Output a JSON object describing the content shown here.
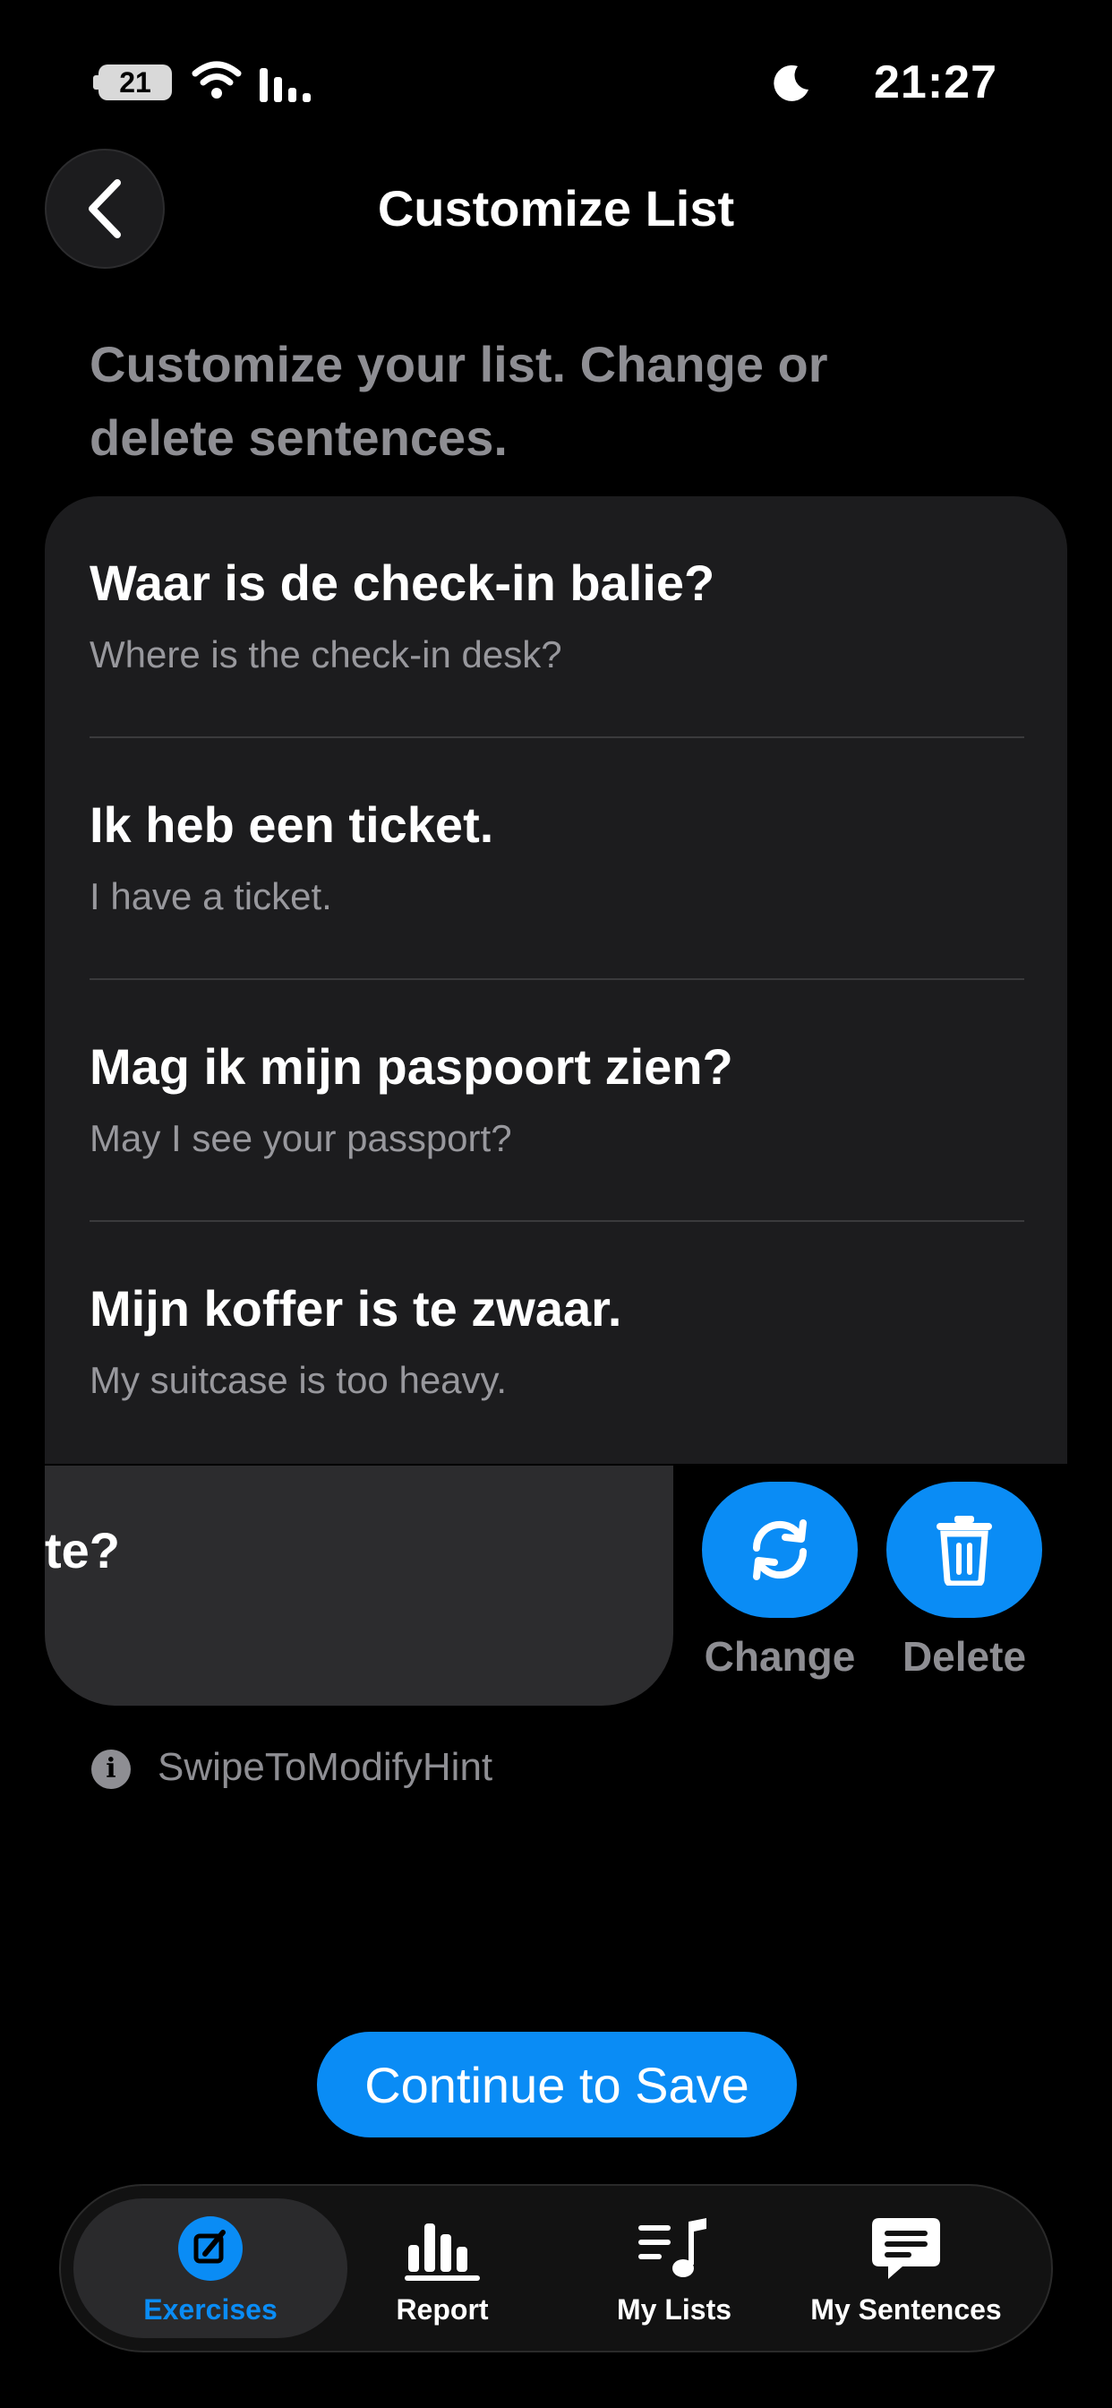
{
  "status_bar": {
    "time": "21:27",
    "battery": "21"
  },
  "header": {
    "title": "Customize List",
    "back_icon": "chevron-left-icon"
  },
  "intro": "Customize your list. Change or delete sentences.",
  "sentences": [
    {
      "nl": "Waar is de check-in balie?",
      "en": "Where is the check-in desk?"
    },
    {
      "nl": "Ik heb een ticket.",
      "en": "I have a ticket."
    },
    {
      "nl": "Mag ik mijn paspoort zien?",
      "en": "May I see your passport?"
    },
    {
      "nl": "Mijn koffer is te zwaar.",
      "en": "My suitcase is too heavy."
    }
  ],
  "swiped_row": {
    "visible_text": "te?"
  },
  "actions": {
    "change_label": "Change",
    "delete_label": "Delete"
  },
  "hint": "SwipeToModifyHint",
  "continue_label": "Continue to Save",
  "tabs": [
    {
      "label": "Exercises",
      "icon": "edit-icon",
      "active": true
    },
    {
      "label": "Report",
      "icon": "bar-chart-icon",
      "active": false
    },
    {
      "label": "My Lists",
      "icon": "music-list-icon",
      "active": false
    },
    {
      "label": "My Sentences",
      "icon": "message-icon",
      "active": false
    }
  ],
  "colors": {
    "accent": "#0a8cf5",
    "background": "#000000",
    "card": "#1c1c1e"
  }
}
